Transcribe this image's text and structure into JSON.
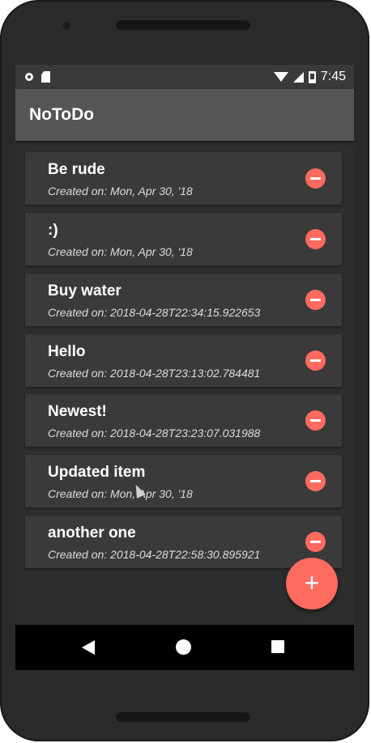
{
  "status_bar": {
    "time": "7:45",
    "icons_left": [
      "circle-icon",
      "sd-card-icon"
    ],
    "icons_right": [
      "wifi-icon",
      "signal-icon",
      "battery-icon"
    ]
  },
  "app_bar": {
    "title": "NoToDo"
  },
  "items": [
    {
      "title": "Be rude",
      "subtitle": "Created on: Mon, Apr 30, '18"
    },
    {
      "title": ":)",
      "subtitle": "Created on: Mon, Apr 30, '18"
    },
    {
      "title": "Buy water",
      "subtitle": "Created on: 2018-04-28T22:34:15.922653"
    },
    {
      "title": "Hello",
      "subtitle": "Created on: 2018-04-28T23:13:02.784481"
    },
    {
      "title": "Newest!",
      "subtitle": "Created on: 2018-04-28T23:23:07.031988"
    },
    {
      "title": "Updated item",
      "subtitle": "Created on: Mon, Apr 30, '18"
    },
    {
      "title": "another one",
      "subtitle": "Created on: 2018-04-28T22:58:30.895921"
    }
  ],
  "fab": {
    "label": "+"
  },
  "nav_bar": {
    "icons": [
      "back-icon",
      "home-icon",
      "recents-icon"
    ]
  },
  "colors": {
    "accent": "#ff6b5f",
    "app_bar": "#555555",
    "background": "#2f2e2f",
    "card": "#3b3a3b"
  }
}
